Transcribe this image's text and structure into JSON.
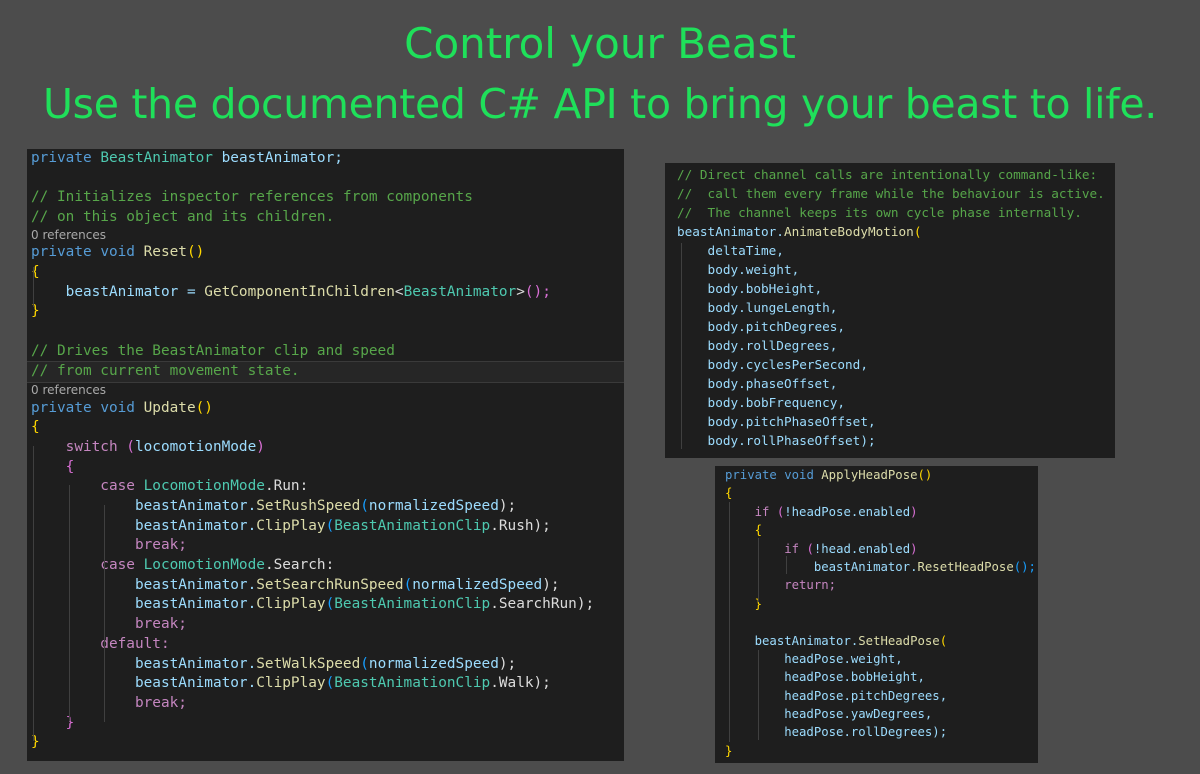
{
  "headline": {
    "line1": "Control your Beast",
    "line2": "Use the documented C# API to bring your beast to life."
  },
  "colors": {
    "background": "#4c4c4c",
    "headline": "#1fe05a",
    "editor_bg": "#1e1e1e",
    "keyword": "#569cd6",
    "control_keyword": "#c586c0",
    "comment": "#57a64a",
    "type": "#4ec9b0",
    "method": "#dcdcaa",
    "identifier": "#9cdcfe"
  },
  "main_code": {
    "l01": {
      "t1": "private",
      "t2": " BeastAnimator",
      "t3": " beastAnimator;"
    },
    "l03": "// Initializes inspector references from components",
    "l04": "// on this object and its children.",
    "ref1": "0 references",
    "l05": {
      "t1": "private",
      "t2": " void",
      "t3": " Reset",
      "t4": "()"
    },
    "l06": "{",
    "l07": {
      "t1": "    beastAnimator = ",
      "t2": "GetComponentInChildren",
      "t3": "<",
      "t4": "BeastAnimator",
      "t5": ">",
      "t6": "();"
    },
    "l08": "}",
    "l10": "// Drives the BeastAnimator clip and speed",
    "l11": "// from current movement state.",
    "ref2": "0 references",
    "l12": {
      "t1": "private",
      "t2": " void",
      "t3": " Update",
      "t4": "()"
    },
    "l13": "{",
    "l14": {
      "t1": "    switch",
      "t2": " (",
      "t3": "locomotionMode",
      "t4": ")"
    },
    "l15": "    {",
    "l16": {
      "t1": "        case",
      "t2": " LocomotionMode",
      "t3": ".Run:"
    },
    "l17": {
      "t1": "            beastAnimator.",
      "t2": "SetRushSpeed",
      "t3": "(",
      "t4": "normalizedSpeed",
      "t5": ");"
    },
    "l18": {
      "t1": "            beastAnimator.",
      "t2": "ClipPlay",
      "t3": "(",
      "t4": "BeastAnimationClip",
      "t5": ".Rush);"
    },
    "l19": "            break;",
    "l20": {
      "t1": "        case",
      "t2": " LocomotionMode",
      "t3": ".Search:"
    },
    "l21": {
      "t1": "            beastAnimator.",
      "t2": "SetSearchRunSpeed",
      "t3": "(",
      "t4": "normalizedSpeed",
      "t5": ");"
    },
    "l22": {
      "t1": "            beastAnimator.",
      "t2": "ClipPlay",
      "t3": "(",
      "t4": "BeastAnimationClip",
      "t5": ".SearchRun);"
    },
    "l23": "            break;",
    "l24": "        default:",
    "l25": {
      "t1": "            beastAnimator.",
      "t2": "SetWalkSpeed",
      "t3": "(",
      "t4": "normalizedSpeed",
      "t5": ");"
    },
    "l26": {
      "t1": "            beastAnimator.",
      "t2": "ClipPlay",
      "t3": "(",
      "t4": "BeastAnimationClip",
      "t5": ".Walk);"
    },
    "l27": "            break;",
    "l28": "    }",
    "l29": "}"
  },
  "body_code": {
    "c1": "// Direct channel calls are intentionally command-like:",
    "c2": "//  call them every frame while the behaviour is active.",
    "c3": "//  The channel keeps its own cycle phase internally.",
    "call": {
      "t1": "beastAnimator.",
      "t2": "AnimateBodyMotion",
      "t3": "("
    },
    "args": [
      "    deltaTime,",
      "    body.weight,",
      "    body.bobHeight,",
      "    body.lungeLength,",
      "    body.pitchDegrees,",
      "    body.rollDegrees,",
      "    body.cyclesPerSecond,",
      "    body.phaseOffset,",
      "    body.bobFrequency,",
      "    body.pitchPhaseOffset,",
      "    body.rollPhaseOffset);"
    ]
  },
  "head_code": {
    "h01": {
      "t1": "private",
      "t2": " void",
      "t3": " ApplyHeadPose",
      "t4": "()"
    },
    "h02": "{",
    "h03": {
      "t1": "    if",
      "t2": " (",
      "t3": "!headPose.enabled",
      "t4": ")"
    },
    "h04": "    {",
    "h05": {
      "t1": "        if",
      "t2": " (",
      "t3": "!head.enabled",
      "t4": ")"
    },
    "h06": {
      "t1": "            beastAnimator.",
      "t2": "ResetHeadPose",
      "t3": "();"
    },
    "h07": "        return;",
    "h08": "    }",
    "h10": {
      "t1": "    beastAnimator.",
      "t2": "SetHeadPose",
      "t3": "("
    },
    "args": [
      "        headPose.weight,",
      "        headPose.bobHeight,",
      "        headPose.pitchDegrees,",
      "        headPose.yawDegrees,",
      "        headPose.rollDegrees);"
    ],
    "h16": "}"
  }
}
